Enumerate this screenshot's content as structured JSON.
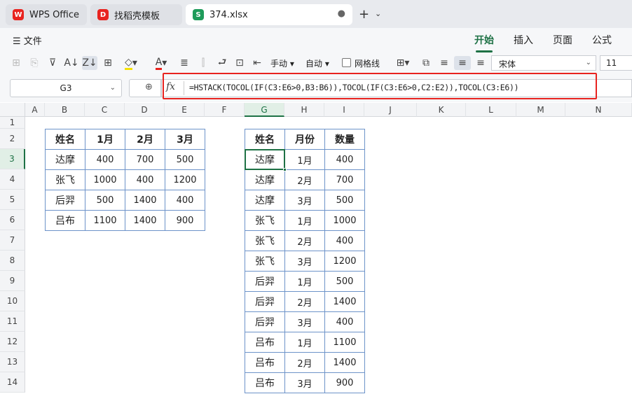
{
  "tabs": [
    {
      "label": "WPS Office",
      "icon": "wps-logo-icon",
      "color": "#e8231f"
    },
    {
      "label": "找稻壳模板",
      "icon": "docer-icon",
      "color": "#e8231f"
    },
    {
      "label": "374.xlsx",
      "icon": "spreadsheet-icon",
      "color": "#1e9b5a"
    }
  ],
  "ribbon": {
    "menu_label": "文件",
    "tabs": [
      "开始",
      "插入",
      "页面",
      "公式"
    ],
    "active_tab": "开始",
    "wrap_manual": "手动",
    "wrap_auto": "自动",
    "gridlines_label": "网格线",
    "font_name": "宋体",
    "font_size": "11"
  },
  "formula_bar": {
    "cell_ref": "G3",
    "fx_label": "fx",
    "formula": "=HSTACK(TOCOL(IF(C3:E6>0,B3:B6)),TOCOL(IF(C3:E6>0,C2:E2)),TOCOL(C3:E6))"
  },
  "columns": [
    "A",
    "B",
    "C",
    "D",
    "E",
    "F",
    "G",
    "H",
    "I",
    "J",
    "K",
    "L",
    "M",
    "N"
  ],
  "active_column": "G",
  "rows": [
    "1",
    "2",
    "3",
    "4",
    "5",
    "6",
    "7",
    "8",
    "9",
    "10",
    "11",
    "12",
    "13",
    "14"
  ],
  "active_row": "3",
  "source_table": {
    "headers": [
      "姓名",
      "1月",
      "2月",
      "3月"
    ],
    "rows": [
      [
        "达摩",
        "400",
        "700",
        "500"
      ],
      [
        "张飞",
        "1000",
        "400",
        "1200"
      ],
      [
        "后羿",
        "500",
        "1400",
        "400"
      ],
      [
        "吕布",
        "1100",
        "1400",
        "900"
      ]
    ]
  },
  "result_table": {
    "headers": [
      "姓名",
      "月份",
      "数量"
    ],
    "rows": [
      [
        "达摩",
        "1月",
        "400"
      ],
      [
        "达摩",
        "2月",
        "700"
      ],
      [
        "达摩",
        "3月",
        "500"
      ],
      [
        "张飞",
        "1月",
        "1000"
      ],
      [
        "张飞",
        "2月",
        "400"
      ],
      [
        "张飞",
        "3月",
        "1200"
      ],
      [
        "后羿",
        "1月",
        "500"
      ],
      [
        "后羿",
        "2月",
        "1400"
      ],
      [
        "后羿",
        "3月",
        "400"
      ],
      [
        "吕布",
        "1月",
        "1100"
      ],
      [
        "吕布",
        "2月",
        "1400"
      ],
      [
        "吕布",
        "3月",
        "900"
      ]
    ]
  },
  "colors": {
    "accent": "#1e7145",
    "highlight_border": "#e8231f",
    "table_border": "#6d93c9"
  }
}
